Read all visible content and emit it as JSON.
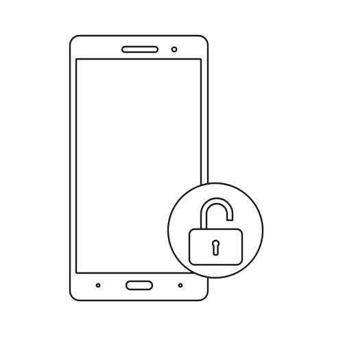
{
  "colors": {
    "background": "#ffffff",
    "stroke": "#1a1a1a"
  },
  "icons": {
    "illustration": "smartphone-icon",
    "badge": "unlocked-padlock-icon"
  }
}
